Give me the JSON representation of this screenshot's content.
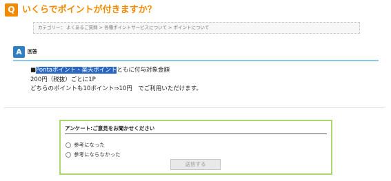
{
  "question": {
    "badge": "Q",
    "title": "いくらでポイントが付きますか？"
  },
  "breadcrumb": {
    "text": "カテゴリー： よくあるご質問 > 各種ポイントサービスについて > ポイントについて"
  },
  "answer": {
    "badge": "A",
    "label": "回答",
    "line1_bullet": "■",
    "line1_highlight": "Pontaポイント・楽天ポイント",
    "line1_rest": "ともに付与対象金額",
    "line2": "200円（税抜）ごとに1P",
    "line3": "どちらのポイントも10ポイント⇒10円　でご利用いただけます。"
  },
  "survey": {
    "title": "アンケート:ご意見をお聞かせください",
    "options": [
      "参考になった",
      "参考にならなかった"
    ],
    "submit_label": "送信する"
  },
  "colors": {
    "accent_orange": "#f08a00",
    "answer_blue": "#2f7fc3",
    "survey_border": "#a8d86a"
  }
}
